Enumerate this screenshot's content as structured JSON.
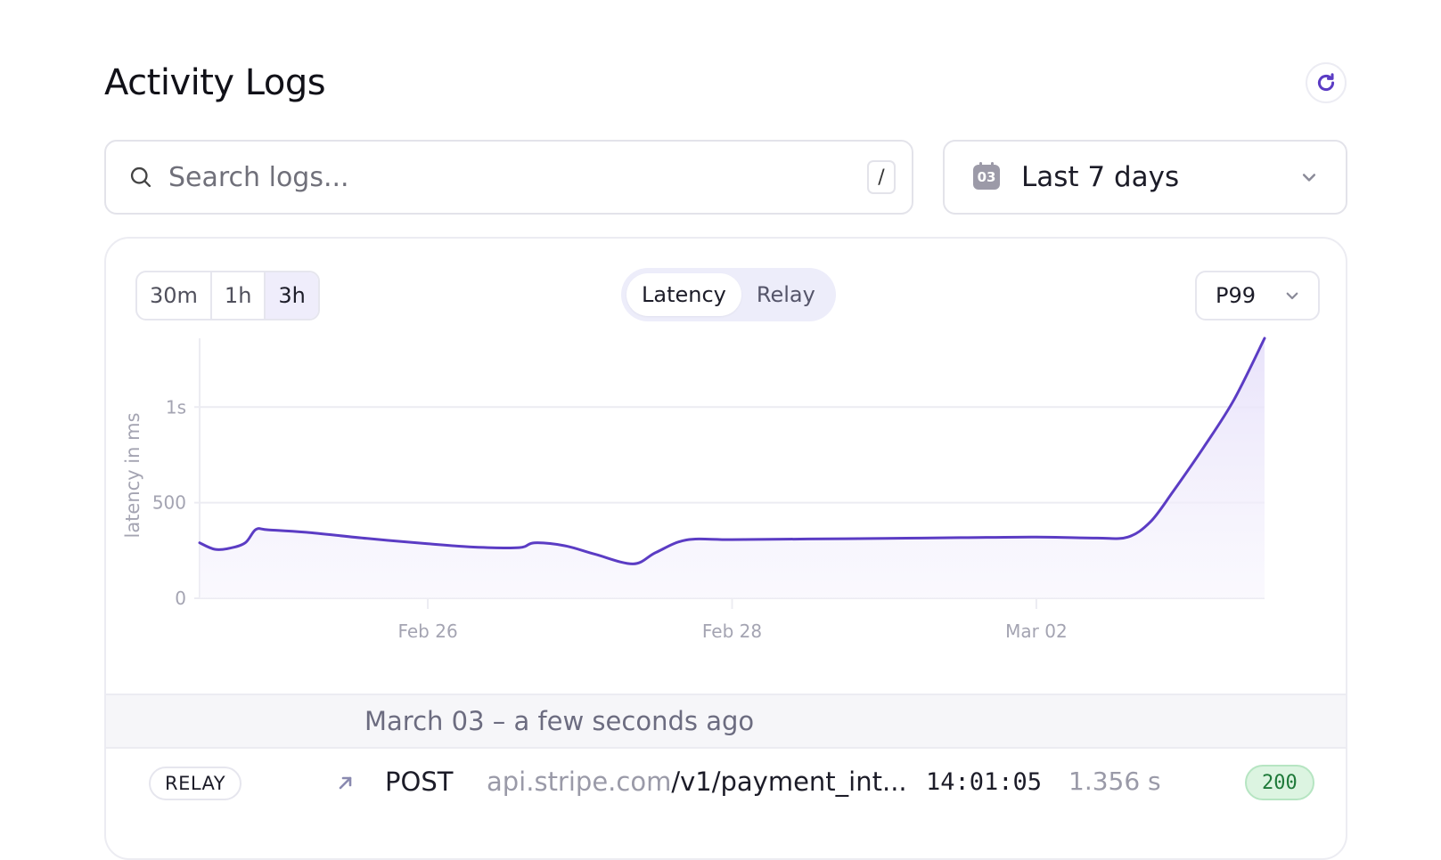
{
  "header": {
    "title": "Activity Logs"
  },
  "search": {
    "placeholder": "Search logs...",
    "shortcut": "/"
  },
  "date_range": {
    "icon_text": "03",
    "selected": "Last 7 days"
  },
  "chart_controls": {
    "windows": [
      "30m",
      "1h",
      "3h"
    ],
    "active_window": "3h",
    "modes": [
      "Latency",
      "Relay"
    ],
    "active_mode": "Latency",
    "percentile": "P99"
  },
  "chart_data": {
    "type": "area",
    "ylabel": "latency in ms",
    "yticks": [
      {
        "value": 0,
        "label": "0"
      },
      {
        "value": 500,
        "label": "500"
      },
      {
        "value": 1000,
        "label": "1s"
      }
    ],
    "xticks": [
      {
        "x": 1.0,
        "label": "Feb 26"
      },
      {
        "x": 3.0,
        "label": "Feb 28"
      },
      {
        "x": 5.0,
        "label": "Mar 02"
      }
    ],
    "xlim": [
      -0.5,
      6.5
    ],
    "ylim": [
      0,
      1360
    ],
    "grid": true,
    "series": [
      {
        "x": [
          -0.5,
          -0.4,
          -0.3,
          -0.2,
          -0.13,
          -0.05,
          0.2,
          0.6,
          1.0,
          1.3,
          1.6,
          1.7,
          1.9,
          2.1,
          2.35,
          2.5,
          2.7,
          3.0,
          3.5,
          4.0,
          4.5,
          5.0,
          5.4,
          5.6,
          5.75,
          5.9,
          6.1,
          6.3,
          6.5
        ],
        "y": [
          290,
          256,
          262,
          290,
          360,
          358,
          345,
          313,
          285,
          268,
          265,
          290,
          275,
          230,
          180,
          240,
          305,
          307,
          310,
          313,
          317,
          320,
          315,
          320,
          400,
          560,
          790,
          1040,
          1360
        ]
      }
    ]
  },
  "logs": {
    "day_label": "March 03 – a few seconds ago",
    "rows": [
      {
        "type": "RELAY",
        "method": "POST",
        "host": "api.stripe.com",
        "path": "/v1/payment_int...",
        "time": "14:01:05",
        "duration": "1.356 s",
        "status": "200"
      }
    ]
  },
  "colors": {
    "accent": "#5b3cc4",
    "area_fill": "#efebfb",
    "grid": "#ececf2",
    "status_ok_bg": "#dcf4e1"
  },
  "icons": {
    "refresh": "refresh-icon",
    "search": "search-icon",
    "calendar": "calendar-icon",
    "chevron": "chevron-down-icon",
    "arrow": "arrow-up-right-icon"
  }
}
